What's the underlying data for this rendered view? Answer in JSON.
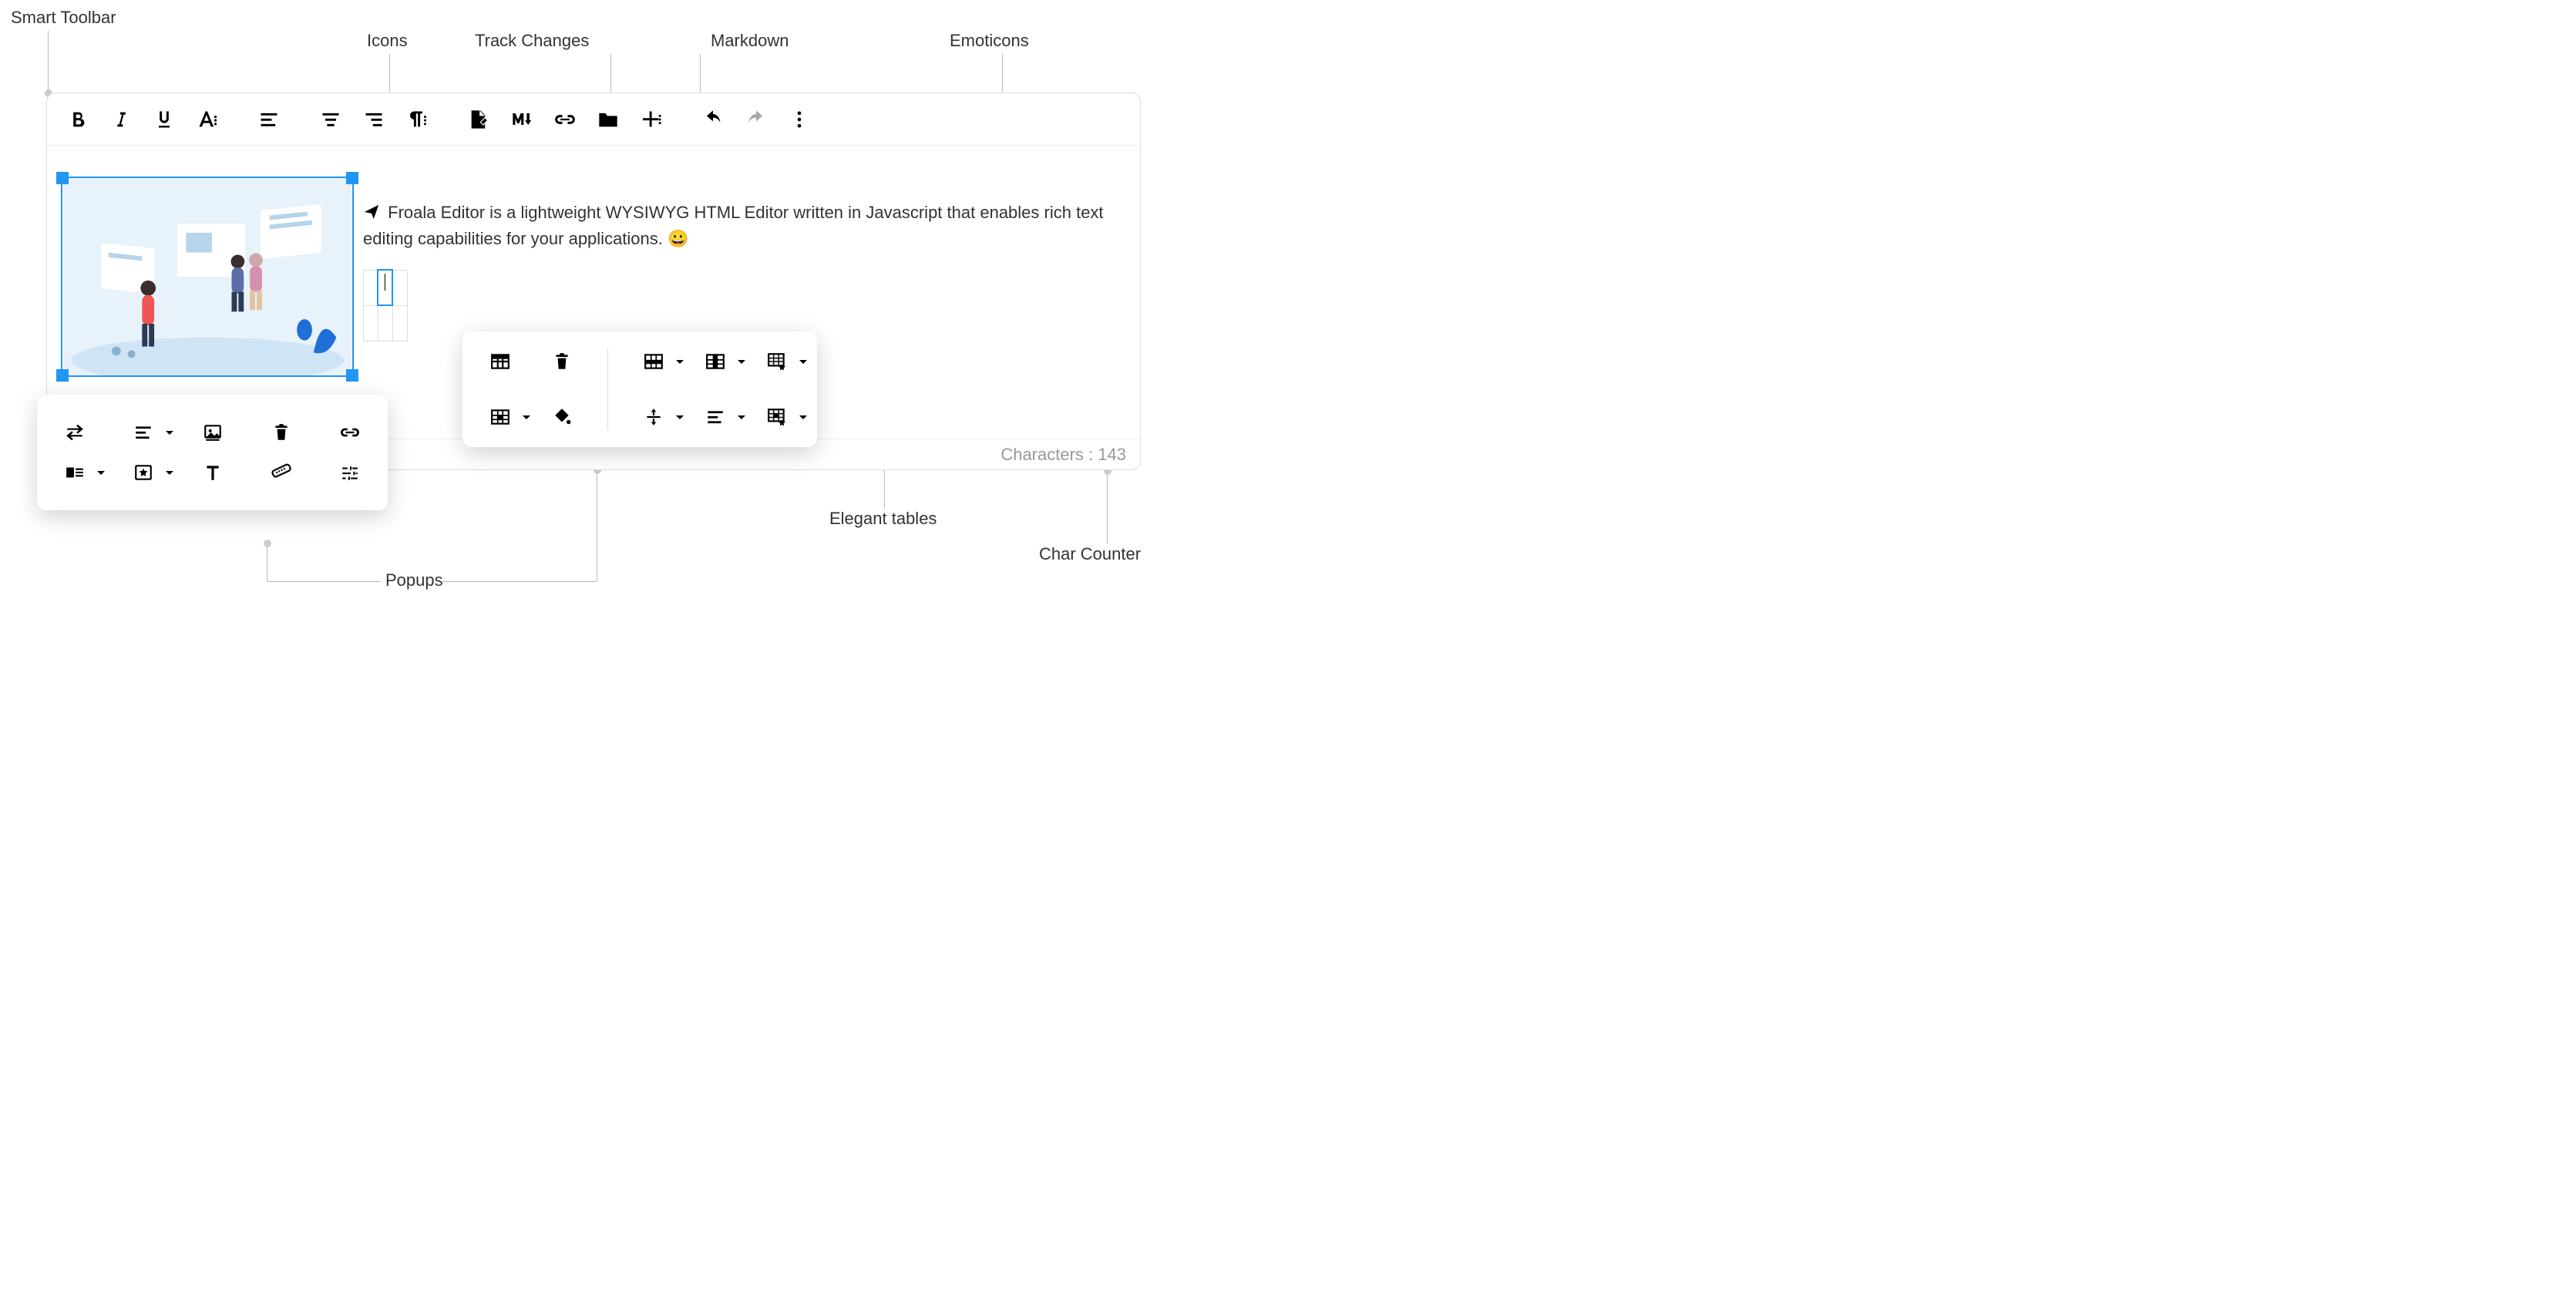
{
  "callouts": {
    "smart_toolbar": "Smart Toolbar",
    "icons": "Icons",
    "track_changes": "Track Changes",
    "markdown": "Markdown",
    "emoticons": "Emoticons",
    "popups": "Popups",
    "elegant_tables": "Elegant tables",
    "char_counter": "Char Counter"
  },
  "toolbar": {
    "bold": "Bold",
    "italic": "Italic",
    "underline": "Underline",
    "more_text": "More Text",
    "align_left": "Align Left",
    "align_center": "Align Center",
    "align_right": "Align Right",
    "paragraph_more": "More Paragraph",
    "track_changes": "Track Changes",
    "markdown": "Markdown",
    "insert_link": "Insert Link",
    "insert_file": "Insert Files",
    "more_rich": "More Rich",
    "undo": "Undo",
    "redo": "Redo",
    "more_misc": "More Misc"
  },
  "content": {
    "paragraph_text": "Froala Editor is a lightweight WYSIWYG HTML Editor written in Javascript that enables rich text editing capabilities for your applications.",
    "emoticon": "😀",
    "table": {
      "rows": 2,
      "cols": 3,
      "selected_cell": [
        0,
        1
      ]
    }
  },
  "image_popup": {
    "replace": "Replace",
    "align": "Align",
    "caption": "Image Caption",
    "remove": "Remove",
    "link": "Insert Link",
    "display": "Display",
    "style": "Style",
    "alt": "Alternative Text",
    "size": "Change Size",
    "advanced": "Advanced Edit"
  },
  "table_popup": {
    "header": "Table Header",
    "remove": "Remove Table",
    "row": "Row",
    "column": "Column",
    "style": "Table Style",
    "cell": "Cell",
    "background": "Cell Background",
    "vertical_align": "Vertical Align",
    "horizontal_align": "Horizontal Align",
    "cell_style": "Cell Style"
  },
  "footer": {
    "char_label": "Characters :",
    "char_count": "143"
  }
}
